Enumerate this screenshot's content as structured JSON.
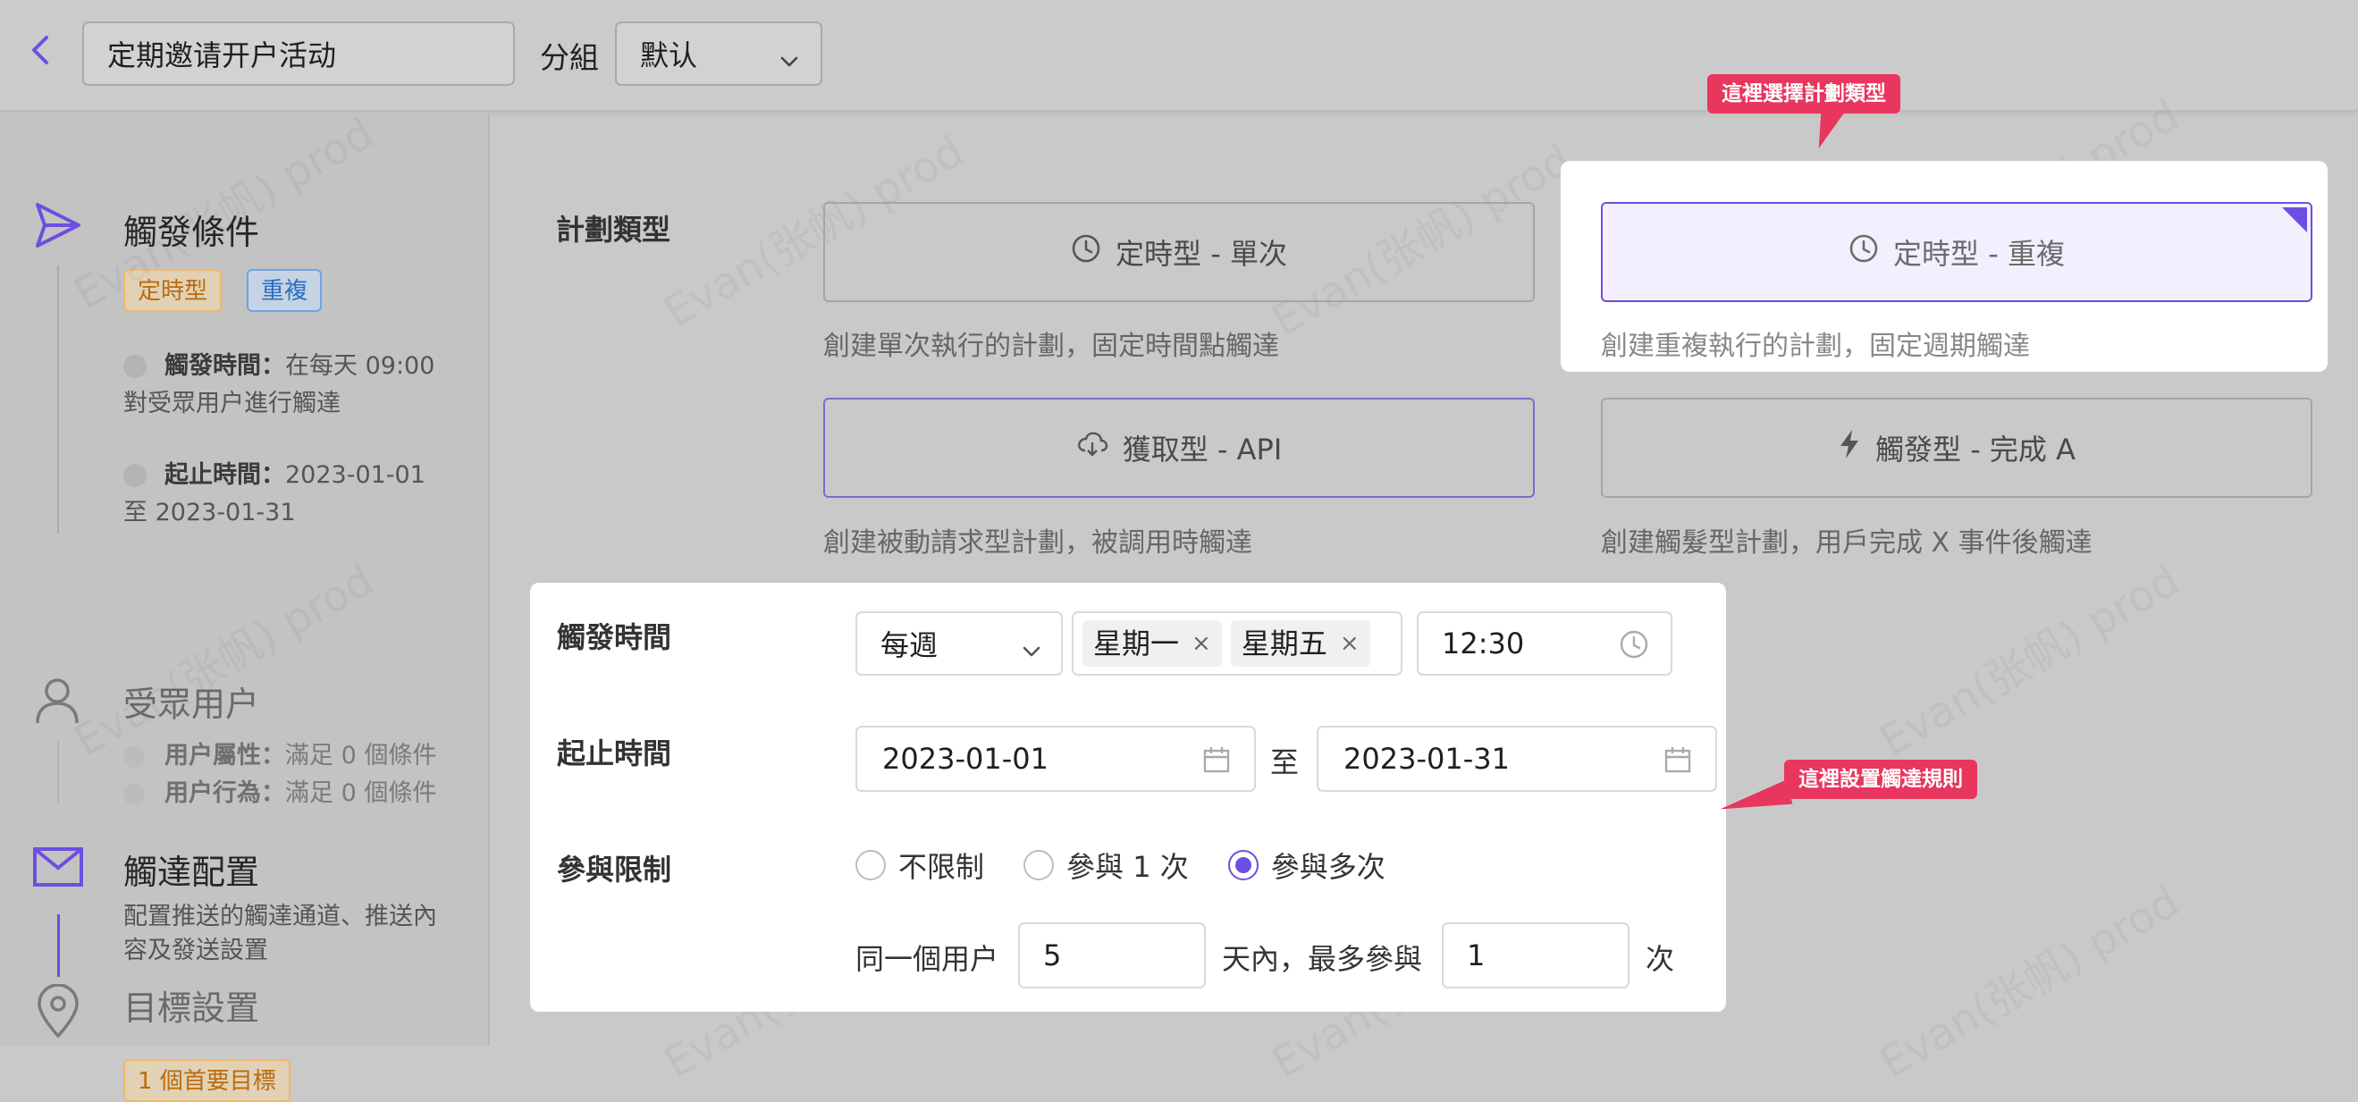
{
  "topbar": {
    "activity_name": "定期邀请开户活动",
    "group_label": "分組",
    "group_value": "默认"
  },
  "sidebar": {
    "trigger": {
      "title": "觸發條件",
      "tags": [
        "定時型",
        "重複"
      ],
      "time_label": "觸發時間：",
      "time_value": "在每天 09:00",
      "time_value_2": "對受眾用户進行觸達",
      "range_label": "起止時間：",
      "range_value": "2023-01-01",
      "range_value_2": "至 2023-01-31"
    },
    "audience": {
      "title": "受眾用户",
      "attr_label": "用户屬性：",
      "attr_value": "滿足 0 個條件",
      "behavior_label": "用户行為：",
      "behavior_value": "滿足 0 個條件"
    },
    "delivery": {
      "title": "觸達配置",
      "desc_1": "配置推送的觸達通道、推送內",
      "desc_2": "容及發送設置"
    },
    "goal": {
      "title": "目標設置",
      "badge": "1 個首要目標"
    }
  },
  "plan": {
    "label": "計劃類型",
    "cards": [
      {
        "title": "定時型 - 單次",
        "desc": "創建單次執行的計劃，固定時間點觸達",
        "icon": "clock-icon"
      },
      {
        "title": "定時型 - 重複",
        "desc": "創建重複執行的計劃，固定週期觸達",
        "icon": "clock-icon"
      },
      {
        "title": "獲取型 - API",
        "desc": "創建被動請求型計劃，被調用時觸達",
        "icon": "cloud-download-icon"
      },
      {
        "title": "觸發型 - 完成 A",
        "desc": "創建觸髮型計劃，用戶完成 X 事件後觸達",
        "icon": "lightning-icon"
      }
    ]
  },
  "form": {
    "trigger_time_label": "觸發時間",
    "frequency": "每週",
    "days": [
      "星期一",
      "星期五"
    ],
    "time": "12:30",
    "range_label": "起止時間",
    "start_date": "2023-01-01",
    "to_label": "至",
    "end_date": "2023-01-31",
    "limit_label": "參與限制",
    "limit_options": [
      "不限制",
      "參與 1 次",
      "參與多次"
    ],
    "limit_selected": 2,
    "same_user_label": "同一個用户",
    "days_value": "5",
    "within_label": "天內，最多參與",
    "times_value": "1",
    "times_unit": "次"
  },
  "callouts": {
    "plan_type": "這裡選擇計劃類型",
    "rules": "這裡設置觸達規則"
  },
  "watermark": "Evan(张帆) prod",
  "colors": {
    "accent": "#6d4fe0",
    "tag_orange": "#f3b768",
    "tag_blue": "#6fa3e6",
    "callout": "#e8365e"
  }
}
